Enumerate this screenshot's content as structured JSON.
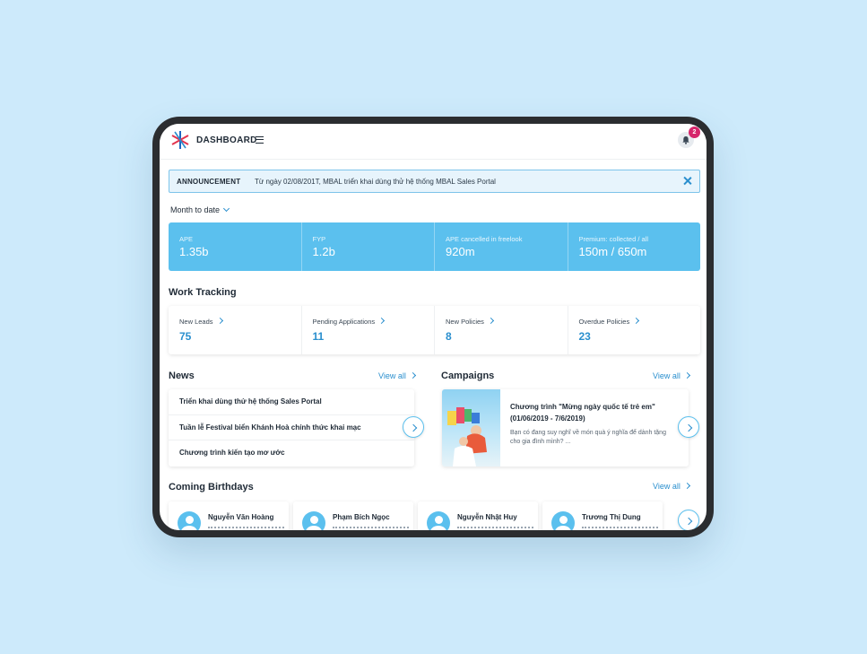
{
  "header": {
    "title": "DASHBOARD",
    "notification_count": "2"
  },
  "announcement": {
    "label": "ANNOUNCEMENT",
    "text": "Từ ngày 02/08/201T,  MBAL triển khai dùng thử hệ thống MBAL Sales Portal"
  },
  "period": {
    "selected": "Month to date"
  },
  "kpis": [
    {
      "label": "APE",
      "value": "1.35b"
    },
    {
      "label": "FYP",
      "value": "1.2b"
    },
    {
      "label": "APE cancelled in freelook",
      "value": "920m"
    },
    {
      "label": "Premium: collected / all",
      "value": "150m / 650m"
    }
  ],
  "work_tracking": {
    "title": "Work Tracking",
    "items": [
      {
        "label": "New Leads",
        "value": "75"
      },
      {
        "label": "Pending Applications",
        "value": "11"
      },
      {
        "label": "New Policies",
        "value": "8"
      },
      {
        "label": "Overdue Policies",
        "value": "23"
      }
    ]
  },
  "news": {
    "title": "News",
    "view_all": "View all",
    "items": [
      "Triển khai dùng thử hệ thống Sales Portal",
      "Tuần lễ Festival biển Khánh Hoà chính thức khai mạc",
      "Chương trình kiến tạo mơ ước"
    ]
  },
  "campaigns": {
    "title": "Campaigns",
    "view_all": "View all",
    "item": {
      "title": "Chương trình \"Mừng ngày quốc tế trẻ em\" (01/06/2019 - 7/6/2019)",
      "description": "Bạn có đang suy nghĩ về món quà ý nghĩa để dành tặng cho gia đình mình? ..."
    }
  },
  "birthdays": {
    "title": "Coming Birthdays",
    "view_all": "View all",
    "items": [
      {
        "name": "Nguyễn Văn Hoàng"
      },
      {
        "name": "Phạm Bích Ngọc"
      },
      {
        "name": "Nguyễn Nhật Huy"
      },
      {
        "name": "Trương Thị Dung"
      }
    ]
  },
  "colors": {
    "accent": "#5bc0ee",
    "link": "#2a8fce",
    "badge": "#d6266b",
    "background": "#cdeafb"
  }
}
